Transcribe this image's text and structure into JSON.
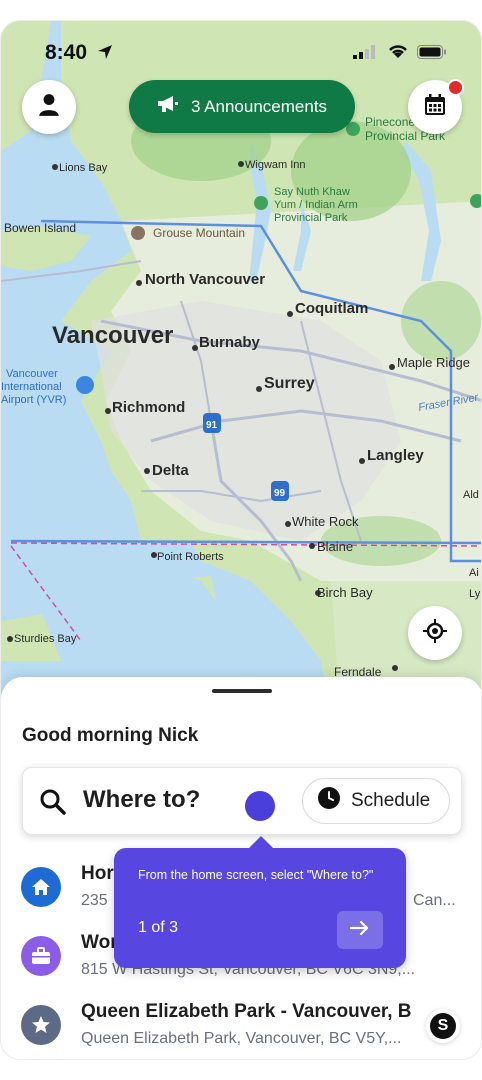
{
  "status_bar": {
    "time": "8:40"
  },
  "colors": {
    "announce_bg": "#0f7a45",
    "tour_bg": "#5747e0",
    "accent": "#4b3fdc",
    "notification": "#e32b2b"
  },
  "top": {
    "announcements_label": "3 Announcements",
    "profile_icon": "person-icon",
    "calendar_icon": "calendar-icon"
  },
  "map": {
    "labels": {
      "vancouver": "Vancouver",
      "north_vancouver": "North Vancouver",
      "burnaby": "Burnaby",
      "coquitlam": "Coquitlam",
      "surrey": "Surrey",
      "richmond": "Richmond",
      "delta": "Delta",
      "langley": "Langley",
      "maple_ridge": "Maple Ridge",
      "white_rock": "White Rock",
      "blaine": "Blaine",
      "birch_bay": "Birch Bay",
      "point_roberts": "Point Roberts",
      "sturdies_bay": "Sturdies Bay",
      "ferndale": "Ferndale",
      "lions_bay": "Lions Bay",
      "wigwam_inn": "Wigwam Inn",
      "bowen_island": "Bowen Island",
      "grouse_mountain": "Grouse Mountain",
      "pinecone": "Pinecone",
      "provincial_park": "Provincial Park",
      "say_nuth_1": "Say Nuth Khaw",
      "say_nuth_2": "Yum / Indian Arm",
      "say_nuth_3": "Provincial Park",
      "airport_1": "Vancouver",
      "airport_2": "International",
      "airport_3": "Airport (YVR)",
      "fraser_river": "Fraser River",
      "ald": "Ald",
      "ai": "Ai",
      "ly": "Ly",
      "hwy_91": "91",
      "hwy_99": "99"
    }
  },
  "sheet": {
    "greeting": "Good morning Nick",
    "search_placeholder": "Where to?",
    "schedule_label": "Schedule",
    "places": [
      {
        "title": "Home",
        "subtitle": "235 ... Can...",
        "icon": "home-icon",
        "color": "#1f6bd6"
      },
      {
        "title": "Work",
        "subtitle": "815 W Hastings St, Vancouver, BC V6C 3N9,...",
        "icon": "briefcase-icon",
        "color": "#8b5ce6"
      },
      {
        "title": "Queen Elizabeth Park - Vancouver, B",
        "subtitle": "Queen Elizabeth Park, Vancouver, BC V5Y,...",
        "icon": "star-icon",
        "color": "#5c6a86"
      }
    ],
    "home_title_visible": "Hor",
    "home_sub_visible": "235",
    "home_sub_tail": "Can...",
    "work_title_visible": "Wor"
  },
  "tour": {
    "text": "From the home screen, select \"Where to?\"",
    "step": "1 of 3"
  },
  "badge": {
    "letter": "S"
  }
}
